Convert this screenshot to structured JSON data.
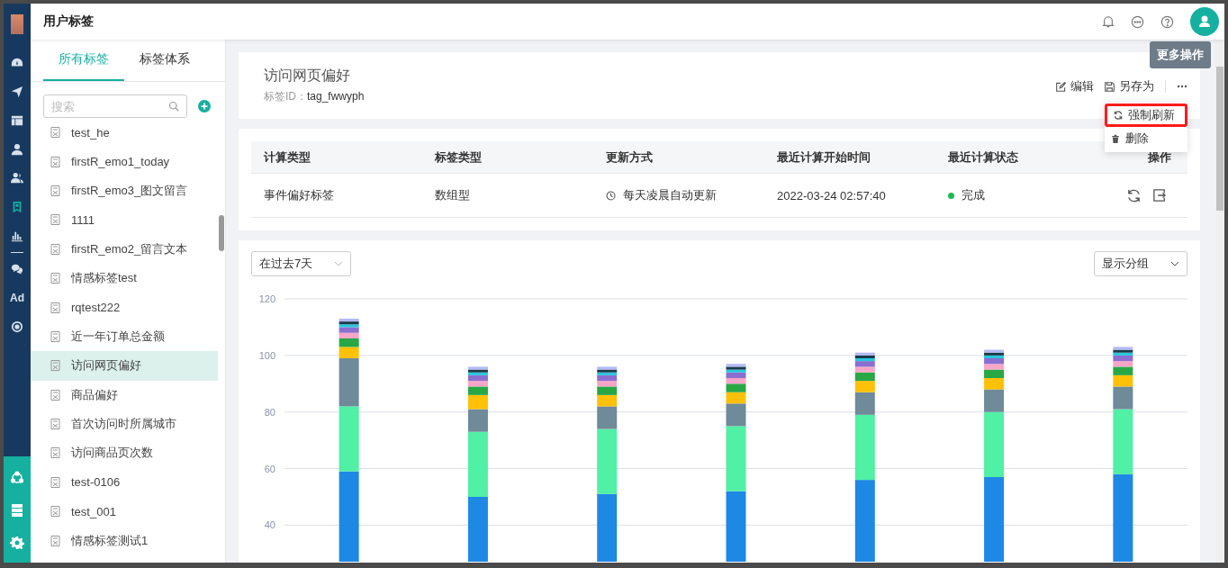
{
  "rail": {
    "items": [
      {
        "selected": false
      },
      {
        "selected": false
      },
      {
        "selected": false
      },
      {
        "selected": false
      },
      {
        "selected": false
      },
      {
        "selected": true
      },
      {
        "selected": false
      },
      {
        "selected": false
      },
      {
        "label": "Ad",
        "selected": false
      },
      {
        "selected": false
      }
    ]
  },
  "header": {
    "title": "用户标签"
  },
  "tooltip": "更多操作",
  "left_panel": {
    "tabs": [
      {
        "label": "所有标签",
        "selected": true
      },
      {
        "label": "标签体系",
        "selected": false
      }
    ],
    "search": {
      "placeholder": "搜索"
    },
    "items": [
      {
        "label": "test_he",
        "selected": false
      },
      {
        "label": "firstR_emo1_today",
        "selected": false
      },
      {
        "label": "firstR_emo3_图文留言",
        "selected": false
      },
      {
        "label": "1111",
        "selected": false
      },
      {
        "label": "firstR_emo2_留言文本",
        "selected": false
      },
      {
        "label": "情感标签test",
        "selected": false
      },
      {
        "label": "rqtest222",
        "selected": false
      },
      {
        "label": "近一年订单总金额",
        "selected": false
      },
      {
        "label": "访问网页偏好",
        "selected": true
      },
      {
        "label": "商品偏好",
        "selected": false
      },
      {
        "label": "首次访问时所属城市",
        "selected": false
      },
      {
        "label": "访问商品页次数",
        "selected": false
      },
      {
        "label": "test-0106",
        "selected": false
      },
      {
        "label": "test_001",
        "selected": false
      },
      {
        "label": "情感标签测试1",
        "selected": false
      }
    ]
  },
  "tag": {
    "title": "访问网页偏好",
    "id_label": "标签ID：",
    "id_value": "tag_fwwyph",
    "actions": [
      "编辑",
      "另存为"
    ]
  },
  "menu": [
    {
      "label": "强制刷新",
      "outlined": true
    },
    {
      "label": "删除",
      "outlined": false
    }
  ],
  "table": {
    "columns": [
      "计算类型",
      "标签类型",
      "更新方式",
      "最近计算开始时间",
      "最近计算状态",
      "操作"
    ],
    "rows": [
      {
        "calc_type": "事件偏好标签",
        "tag_type": "数组型",
        "update_mode": "每天凌晨自动更新",
        "start_time": "2022-03-24 02:57:40",
        "status": {
          "label": "完成",
          "color": "#1db954"
        }
      }
    ]
  },
  "range_select": "在过去7天",
  "group_select": "显示分组",
  "chart_data": {
    "type": "bar",
    "stacked": true,
    "grid": true,
    "ylim": [
      0,
      120
    ],
    "yticks": [
      40,
      60,
      80,
      100,
      120
    ],
    "series": [
      {
        "color": "#1e88e5",
        "values": [
          59,
          50,
          51,
          52,
          56,
          57,
          58
        ]
      },
      {
        "color": "#50f0a5",
        "values": [
          23,
          23,
          23,
          23,
          23,
          23,
          23
        ]
      },
      {
        "color": "#6f8a99",
        "values": [
          17,
          8,
          8,
          8,
          8,
          8,
          8
        ]
      },
      {
        "color": "#ffc107",
        "values": [
          4,
          5,
          4,
          4,
          4,
          4,
          4
        ]
      },
      {
        "color": "#28a745",
        "values": [
          3,
          3,
          3,
          3,
          3,
          3,
          3
        ]
      },
      {
        "color": "#f8a5c8",
        "values": [
          2,
          2,
          2,
          2,
          2,
          2,
          2
        ]
      },
      {
        "color": "#8a6fd0",
        "values": [
          2,
          2,
          2,
          2,
          2,
          2,
          2
        ]
      },
      {
        "color": "#26c6da",
        "values": [
          1,
          1,
          1,
          1,
          1,
          1,
          1
        ]
      },
      {
        "color": "#1a3a4a",
        "values": [
          1,
          1,
          1,
          1,
          1,
          1,
          1
        ]
      },
      {
        "color": "#b3b9f5",
        "values": [
          1,
          1,
          1,
          1,
          1,
          1,
          1
        ]
      }
    ]
  }
}
